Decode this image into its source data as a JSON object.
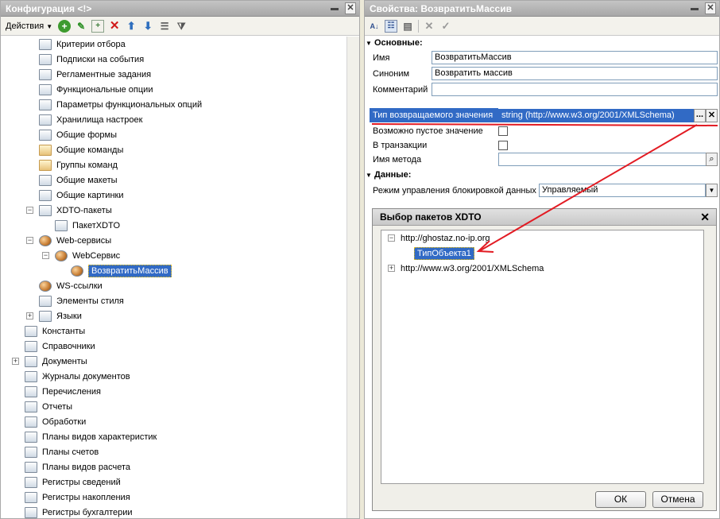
{
  "left_panel": {
    "title": "Конфигурация <!>",
    "toolbar": {
      "actions_label": "Действия",
      "buttons": [
        "add-icon",
        "edit-icon",
        "copy-icon",
        "delete-icon",
        "move-up-icon",
        "move-down-icon",
        "list-icon",
        "filter-icon"
      ]
    },
    "tree": [
      {
        "label": "Критерии отбора",
        "icon": "filter-criteria-icon"
      },
      {
        "label": "Подписки на события",
        "icon": "subscription-icon"
      },
      {
        "label": "Регламентные задания",
        "icon": "clock-icon"
      },
      {
        "label": "Функциональные опции",
        "icon": "option-icon"
      },
      {
        "label": "Параметры функциональных опций",
        "icon": "params-icon"
      },
      {
        "label": "Хранилища настроек",
        "icon": "storage-icon"
      },
      {
        "label": "Общие формы",
        "icon": "form-icon"
      },
      {
        "label": "Общие команды",
        "icon": "command-icon"
      },
      {
        "label": "Группы команд",
        "icon": "command-group-icon"
      },
      {
        "label": "Общие макеты",
        "icon": "template-icon"
      },
      {
        "label": "Общие картинки",
        "icon": "picture-icon"
      },
      {
        "label": "XDTO-пакеты",
        "icon": "xdto-icon"
      },
      {
        "label": "ПакетXDTO",
        "icon": "package-icon"
      },
      {
        "label": "Web-сервисы",
        "icon": "webservice-icon"
      },
      {
        "label": "WebСервис",
        "icon": "webservice-icon"
      },
      {
        "label": "ВозвратитьМассив",
        "icon": "operation-icon"
      },
      {
        "label": "WS-ссылки",
        "icon": "ws-link-icon"
      },
      {
        "label": "Элементы стиля",
        "icon": "style-icon"
      },
      {
        "label": "Языки",
        "icon": "language-icon"
      },
      {
        "label": "Константы",
        "icon": "constant-icon"
      },
      {
        "label": "Справочники",
        "icon": "catalog-icon"
      },
      {
        "label": "Документы",
        "icon": "document-icon"
      },
      {
        "label": "Журналы документов",
        "icon": "journal-icon"
      },
      {
        "label": "Перечисления",
        "icon": "enum-icon"
      },
      {
        "label": "Отчеты",
        "icon": "report-icon"
      },
      {
        "label": "Обработки",
        "icon": "processing-icon"
      },
      {
        "label": "Планы видов характеристик",
        "icon": "chart-char-icon"
      },
      {
        "label": "Планы счетов",
        "icon": "accounts-icon"
      },
      {
        "label": "Планы видов расчета",
        "icon": "calc-icon"
      },
      {
        "label": "Регистры сведений",
        "icon": "info-register-icon"
      },
      {
        "label": "Регистры накопления",
        "icon": "accum-register-icon"
      },
      {
        "label": "Регистры бухгалтерии",
        "icon": "account-register-icon"
      }
    ]
  },
  "right_panel": {
    "title": "Свойства: ВозвратитьМассив",
    "sections": {
      "main": "Основные:",
      "data": "Данные:"
    },
    "fields": {
      "name_label": "Имя",
      "name_value": "ВозвратитьМассив",
      "synonym_label": "Синоним",
      "synonym_value": "Возвратить массив",
      "comment_label": "Комментарий",
      "comment_value": "",
      "return_type_label": "Тип возвращаемого значения",
      "return_type_value": "string (http://www.w3.org/2001/XMLSchema)",
      "nullable_label": "Возможно пустое значение",
      "transaction_label": "В транзакции",
      "method_label": "Имя метода",
      "method_value": "",
      "lock_label": "Режим управления блокировкой данных",
      "lock_value": "Управляемый"
    },
    "ellipsis": "..."
  },
  "dialog": {
    "title": "Выбор пакетов XDTO",
    "tree": [
      {
        "label": "http://ghostaz.no-ip.org"
      },
      {
        "label": "ТипОбъекта1"
      },
      {
        "label": "http://www.w3.org/2001/XMLSchema"
      }
    ],
    "ok_label": "ОК",
    "cancel_label": "Отмена"
  },
  "annotation_color": "#e21b23",
  "selection_color": "#316ac5"
}
